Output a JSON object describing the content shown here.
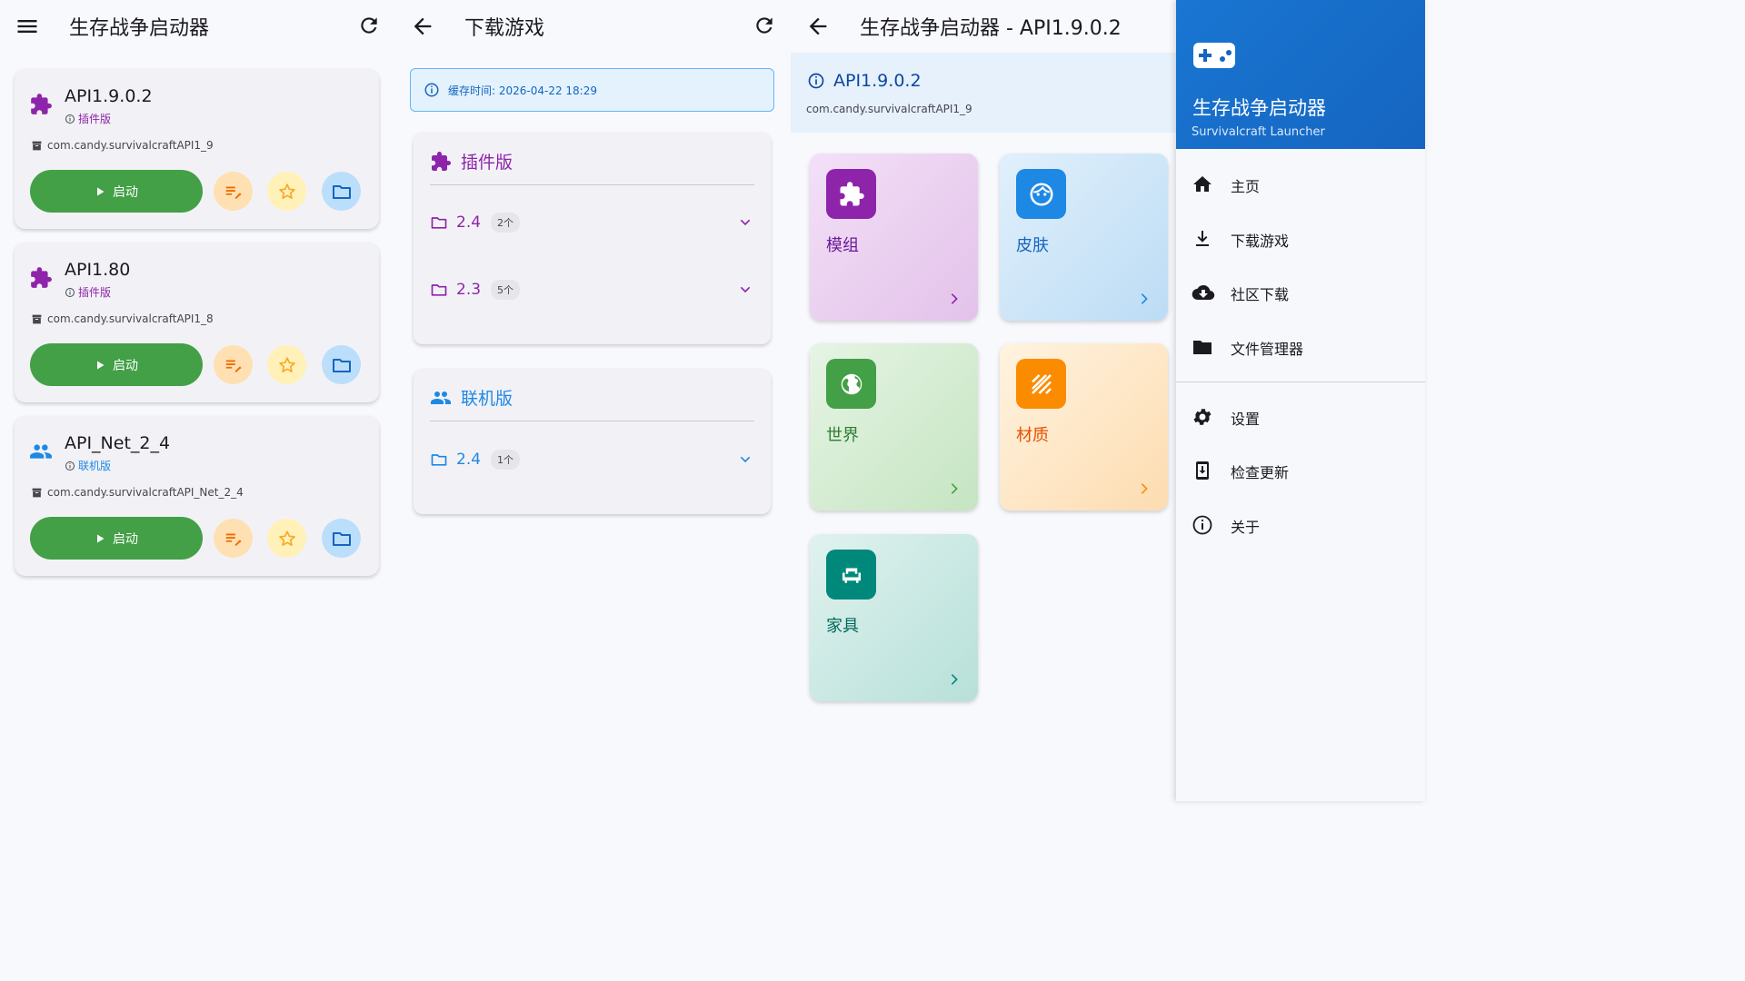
{
  "colors": {
    "primary_blue": "#1565c0",
    "purple": "#8e24aa",
    "green": "#43a047",
    "orange": "#ef6c00",
    "teal": "#00897b"
  },
  "home": {
    "title": "生存战争启动器",
    "menu_icon": "menu-icon",
    "refresh_icon": "refresh-icon",
    "games": [
      {
        "name": "API1.9.0.2",
        "type": "插件版",
        "type_color": "#8e24aa",
        "icon": "puzzle-icon",
        "package": "com.candy.survivalcraftAPI1_9",
        "launch_label": "启动"
      },
      {
        "name": "API1.80",
        "type": "插件版",
        "type_color": "#8e24aa",
        "icon": "puzzle-icon",
        "package": "com.candy.survivalcraftAPI1_8",
        "launch_label": "启动"
      },
      {
        "name": "API_Net_2_4",
        "type": "联机版",
        "type_color": "#1e88e5",
        "icon": "people-icon",
        "package": "com.candy.survivalcraftAPI_Net_2_4",
        "launch_label": "启动"
      }
    ]
  },
  "download": {
    "title": "下载游戏",
    "cache_text": "缓存时间: 2026-04-22 18:29",
    "sections": [
      {
        "label": "插件版",
        "color": "#8e24aa",
        "icon": "puzzle-icon",
        "versions": [
          {
            "version": "2.4",
            "count": "2个"
          },
          {
            "version": "2.3",
            "count": "5个"
          }
        ]
      },
      {
        "label": "联机版",
        "color": "#1e88e5",
        "icon": "people-icon",
        "versions": [
          {
            "version": "2.4",
            "count": "1个"
          }
        ]
      }
    ]
  },
  "detail": {
    "title": "生存战争启动器 - API1.9.0.2",
    "version": "API1.9.0.2",
    "package": "com.candy.survivalcraftAPI1_9",
    "tiles": [
      {
        "label": "模组",
        "icon": "puzzle-icon",
        "accent": "#8e24aa",
        "text_color": "#6a1b9a"
      },
      {
        "label": "皮肤",
        "icon": "face-icon",
        "accent": "#1e88e5",
        "text_color": "#1565c0"
      },
      {
        "label": "世界",
        "icon": "globe-icon",
        "accent": "#43a047",
        "text_color": "#2e7d32"
      },
      {
        "label": "材质",
        "icon": "texture-icon",
        "accent": "#fb8c00",
        "text_color": "#e65100"
      },
      {
        "label": "家具",
        "icon": "sofa-icon",
        "accent": "#00897b",
        "text_color": "#00695c"
      }
    ]
  },
  "drawer": {
    "title": "生存战争启动器",
    "subtitle": "Survivalcraft Launcher",
    "logo": "gamepad-icon",
    "items": [
      {
        "label": "主页",
        "icon": "home-icon"
      },
      {
        "label": "下载游戏",
        "icon": "download-icon"
      },
      {
        "label": "社区下载",
        "icon": "cloud-download-icon"
      },
      {
        "label": "文件管理器",
        "icon": "folder-icon"
      },
      {
        "label": "设置",
        "icon": "gear-icon"
      },
      {
        "label": "检查更新",
        "icon": "system-update-icon"
      },
      {
        "label": "关于",
        "icon": "info-icon"
      }
    ]
  }
}
